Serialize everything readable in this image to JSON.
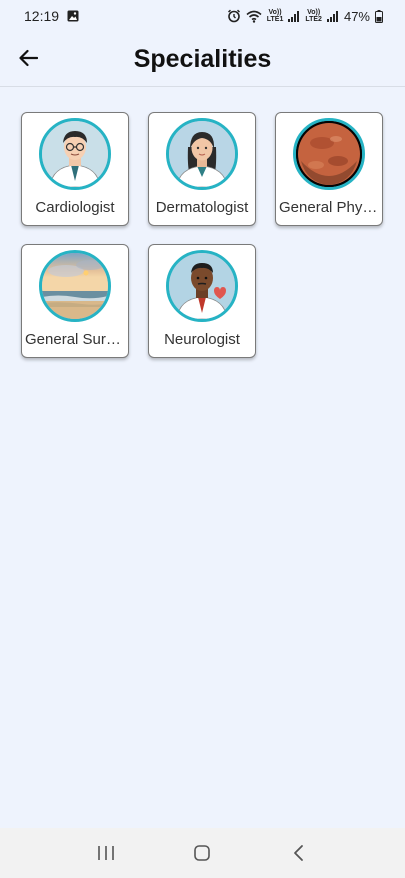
{
  "status_bar": {
    "time": "12:19",
    "sim1": "Vo))\nLTE1",
    "sim2": "Vo))\nLTE2",
    "battery": "47%",
    "icons": [
      "gallery-icon",
      "alarm-icon",
      "wifi-icon",
      "signal-icon",
      "battery-icon"
    ]
  },
  "header": {
    "title": "Specialities",
    "back_icon": "arrow-left-icon"
  },
  "specialities": [
    {
      "label": "Cardiologist",
      "image": "doctor-male-glasses"
    },
    {
      "label": "Dermatologist",
      "image": "doctor-female"
    },
    {
      "label": "General Physician",
      "image": "planet-mars"
    },
    {
      "label": "General Surgeon",
      "image": "beach-sunset"
    },
    {
      "label": "Neurologist",
      "image": "doctor-male-heart"
    }
  ],
  "nav": {
    "icons": [
      "recent-apps-icon",
      "home-icon",
      "back-icon"
    ]
  },
  "colors": {
    "background": "#eef3fd",
    "avatar_ring": "#26b3c4",
    "navbar": "#f2f2f2"
  }
}
